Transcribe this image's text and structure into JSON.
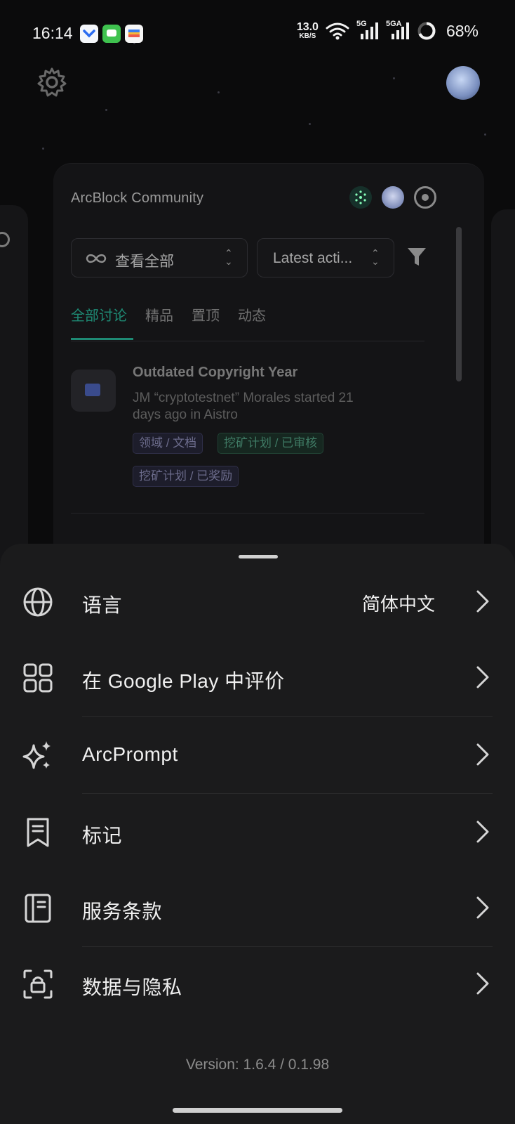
{
  "status_bar": {
    "time": "16:14",
    "net_speed_value": "13.0",
    "net_speed_unit": "KB/S",
    "sim1": "5G",
    "sim2": "5GA",
    "battery": "68%"
  },
  "card": {
    "title": "ArcBlock Community",
    "filter_scope": "查看全部",
    "sort": "Latest acti...",
    "tabs": [
      "全部讨论",
      "精品",
      "置顶",
      "动态"
    ],
    "active_tab": "全部讨论",
    "post": {
      "title": "Outdated Copyright Year",
      "meta": "JM “cryptotestnet” Morales started 21 days ago in Aistro",
      "tags": [
        "领域 / 文档",
        "挖矿计划 / 已审核",
        "挖矿计划 / 已奖励"
      ]
    }
  },
  "sheet": {
    "items": [
      {
        "label": "语言",
        "value": "简体中文",
        "icon": "globe-icon"
      },
      {
        "label": "在 Google Play 中评价",
        "icon": "apps-grid-icon"
      },
      {
        "label": "ArcPrompt",
        "icon": "sparkles-icon"
      },
      {
        "label": "标记",
        "icon": "bookmark-icon"
      },
      {
        "label": "服务条款",
        "icon": "notebook-icon"
      },
      {
        "label": "数据与隐私",
        "icon": "lock-frame-icon"
      }
    ],
    "version": "Version: 1.6.4 / 0.1.98"
  },
  "colors": {
    "accent": "#1e8a74",
    "sheet_bg": "#1b1b1c",
    "page_bg": "#0b0b0c"
  }
}
